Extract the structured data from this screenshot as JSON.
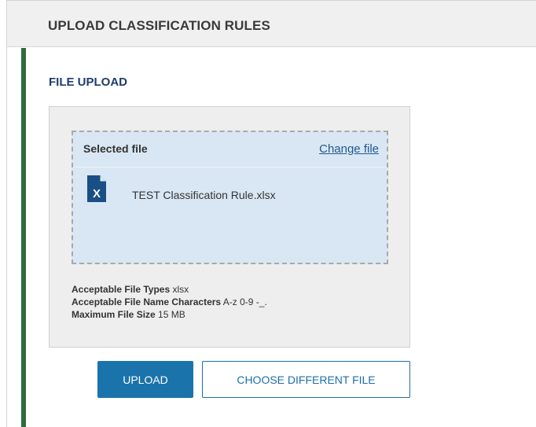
{
  "header": {
    "title": "UPLOAD CLASSIFICATION RULES"
  },
  "section": {
    "title": "FILE UPLOAD"
  },
  "dropzone": {
    "label": "Selected file",
    "change_link": "Change file",
    "file_name": "TEST Classification Rule.xlsx",
    "file_icon": "excel-file-icon",
    "file_icon_letter": "X"
  },
  "requirements": {
    "file_types_label": "Acceptable File Types",
    "file_types_value": "xlsx",
    "name_chars_label": "Acceptable File Name Characters",
    "name_chars_value": "A-z 0-9 -_.",
    "max_size_label": "Maximum File Size",
    "max_size_value": "15 MB"
  },
  "actions": {
    "upload_label": "UPLOAD",
    "choose_label": "CHOOSE DIFFERENT FILE"
  },
  "colors": {
    "accent": "#2e6b3e",
    "primary": "#1b73ac",
    "dropzone_bg": "#d9e7f4",
    "section_title": "#1e3c6e"
  }
}
